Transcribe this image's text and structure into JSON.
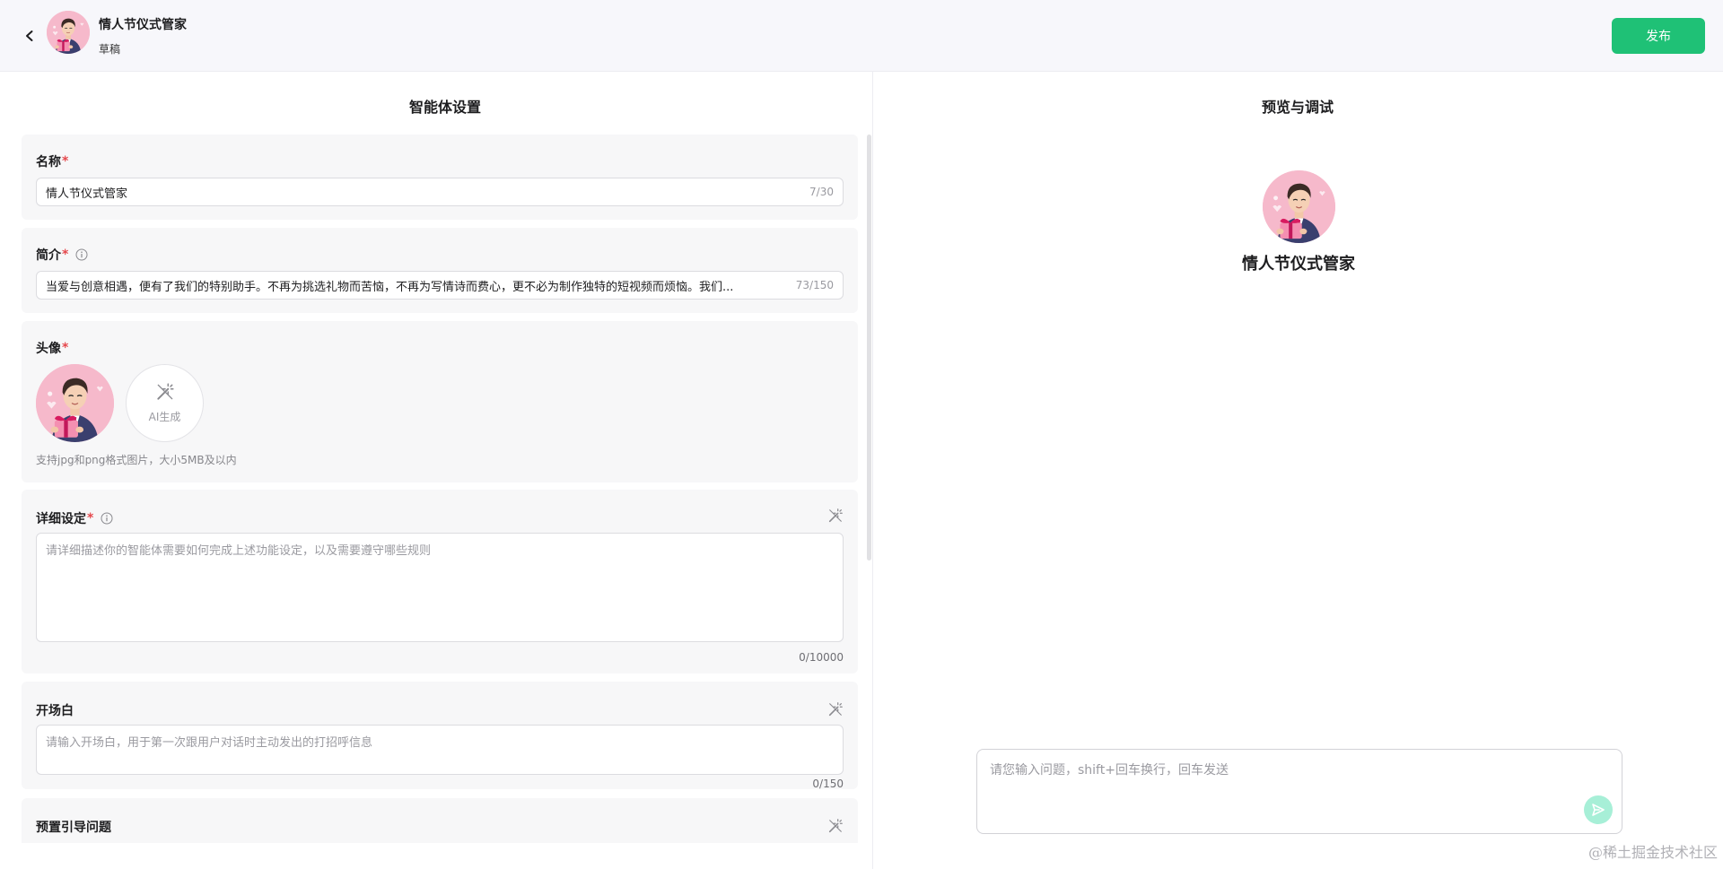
{
  "header": {
    "title": "情人节仪式管家",
    "status": "草稿",
    "publish_label": "发布"
  },
  "left": {
    "title": "智能体设置",
    "name": {
      "label": "名称",
      "value": "情人节仪式管家",
      "counter": "7/30"
    },
    "intro": {
      "label": "简介",
      "value": "当爱与创意相遇，便有了我们的特别助手。不再为挑选礼物而苦恼，不再为写情诗而费心，更不必为制作独特的短视频而烦恼。我们...",
      "counter": "73/150"
    },
    "avatar": {
      "label": "头像",
      "ai_label": "AI生成",
      "hint": "支持jpg和png格式图片，大小5MB及以内"
    },
    "detail": {
      "label": "详细设定",
      "placeholder": "请详细描述你的智能体需要如何完成上述功能设定，以及需要遵守哪些规则",
      "counter": "0/10000"
    },
    "opening": {
      "label": "开场白",
      "placeholder": "请输入开场白，用于第一次跟用户对话时主动发出的打招呼信息",
      "counter": "0/150"
    },
    "preset": {
      "label": "预置引导问题"
    }
  },
  "right": {
    "title": "预览与调试",
    "agent_name": "情人节仪式管家",
    "chat_placeholder": "请您输入问题，shift+回车换行，回车发送"
  },
  "watermark": "@稀土掘金技术社区",
  "colors": {
    "accent": "#1fc176",
    "required": "#e5484d",
    "send_disabled": "#a7efd7"
  }
}
